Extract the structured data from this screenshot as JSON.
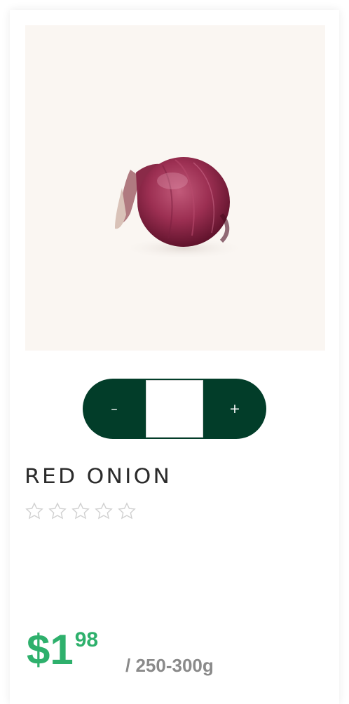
{
  "product": {
    "name": "RED ONION",
    "image_alt": "red-onion-photo",
    "rating": {
      "value": 0,
      "max": 5
    },
    "price": {
      "currency": "$",
      "dollars": "1",
      "cents": "98"
    },
    "unit": "/ 250-300g"
  },
  "stepper": {
    "decrement_label": "–",
    "increment_label": "+",
    "quantity": ""
  },
  "colors": {
    "stepper": "#023d29",
    "price": "#2eb06c",
    "title": "#2b2b2b",
    "unit": "#8a8a8a",
    "image_bg": "#faf6f2",
    "star_outline": "#d0d0d0"
  },
  "icons": {
    "rating_star": "star-outline-icon"
  }
}
